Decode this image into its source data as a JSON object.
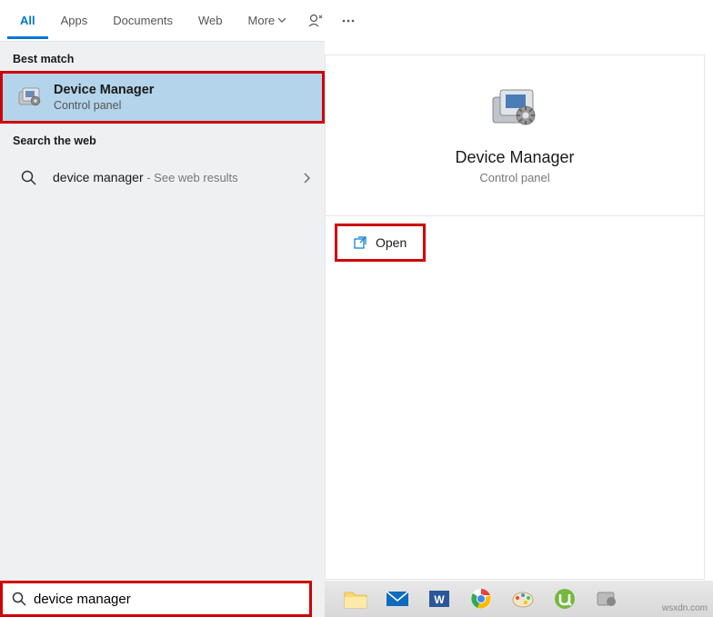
{
  "tabs": {
    "all": "All",
    "apps": "Apps",
    "documents": "Documents",
    "web": "Web",
    "more": "More"
  },
  "sections": {
    "best_match": "Best match",
    "search_web": "Search the web"
  },
  "best_match": {
    "title": "Device Manager",
    "subtitle": "Control panel"
  },
  "web_result": {
    "query": "device manager",
    "hint": " - See web results"
  },
  "detail": {
    "title": "Device Manager",
    "subtitle": "Control panel",
    "open": "Open"
  },
  "search": {
    "value": "device manager"
  },
  "watermark": "wsxdn.com"
}
